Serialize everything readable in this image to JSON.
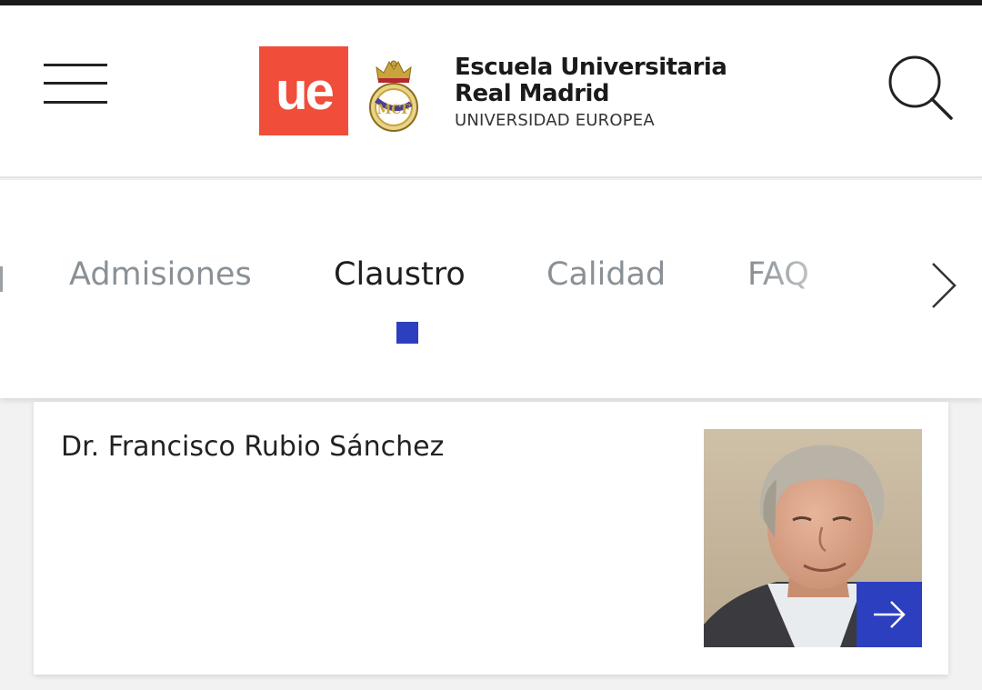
{
  "header": {
    "logo_text": "ue",
    "brand_line1": "Escuela Universitaria",
    "brand_line2": "Real Madrid",
    "brand_sub": "UNIVERSIDAD EUROPEA",
    "menu_icon": "hamburger-menu-icon",
    "search_icon": "search-icon",
    "logo_color": "#f04e3a"
  },
  "tabs": {
    "items": [
      {
        "label": "Admisiones",
        "active": false
      },
      {
        "label": "Claustro",
        "active": true
      },
      {
        "label": "Calidad",
        "active": false
      },
      {
        "label": "FAQ",
        "active": false
      }
    ],
    "next_icon": "chevron-right-icon",
    "accent_color": "#2b3fbf"
  },
  "card": {
    "name": "Dr. Francisco Rubio Sánchez",
    "arrow_icon": "arrow-right-icon"
  }
}
